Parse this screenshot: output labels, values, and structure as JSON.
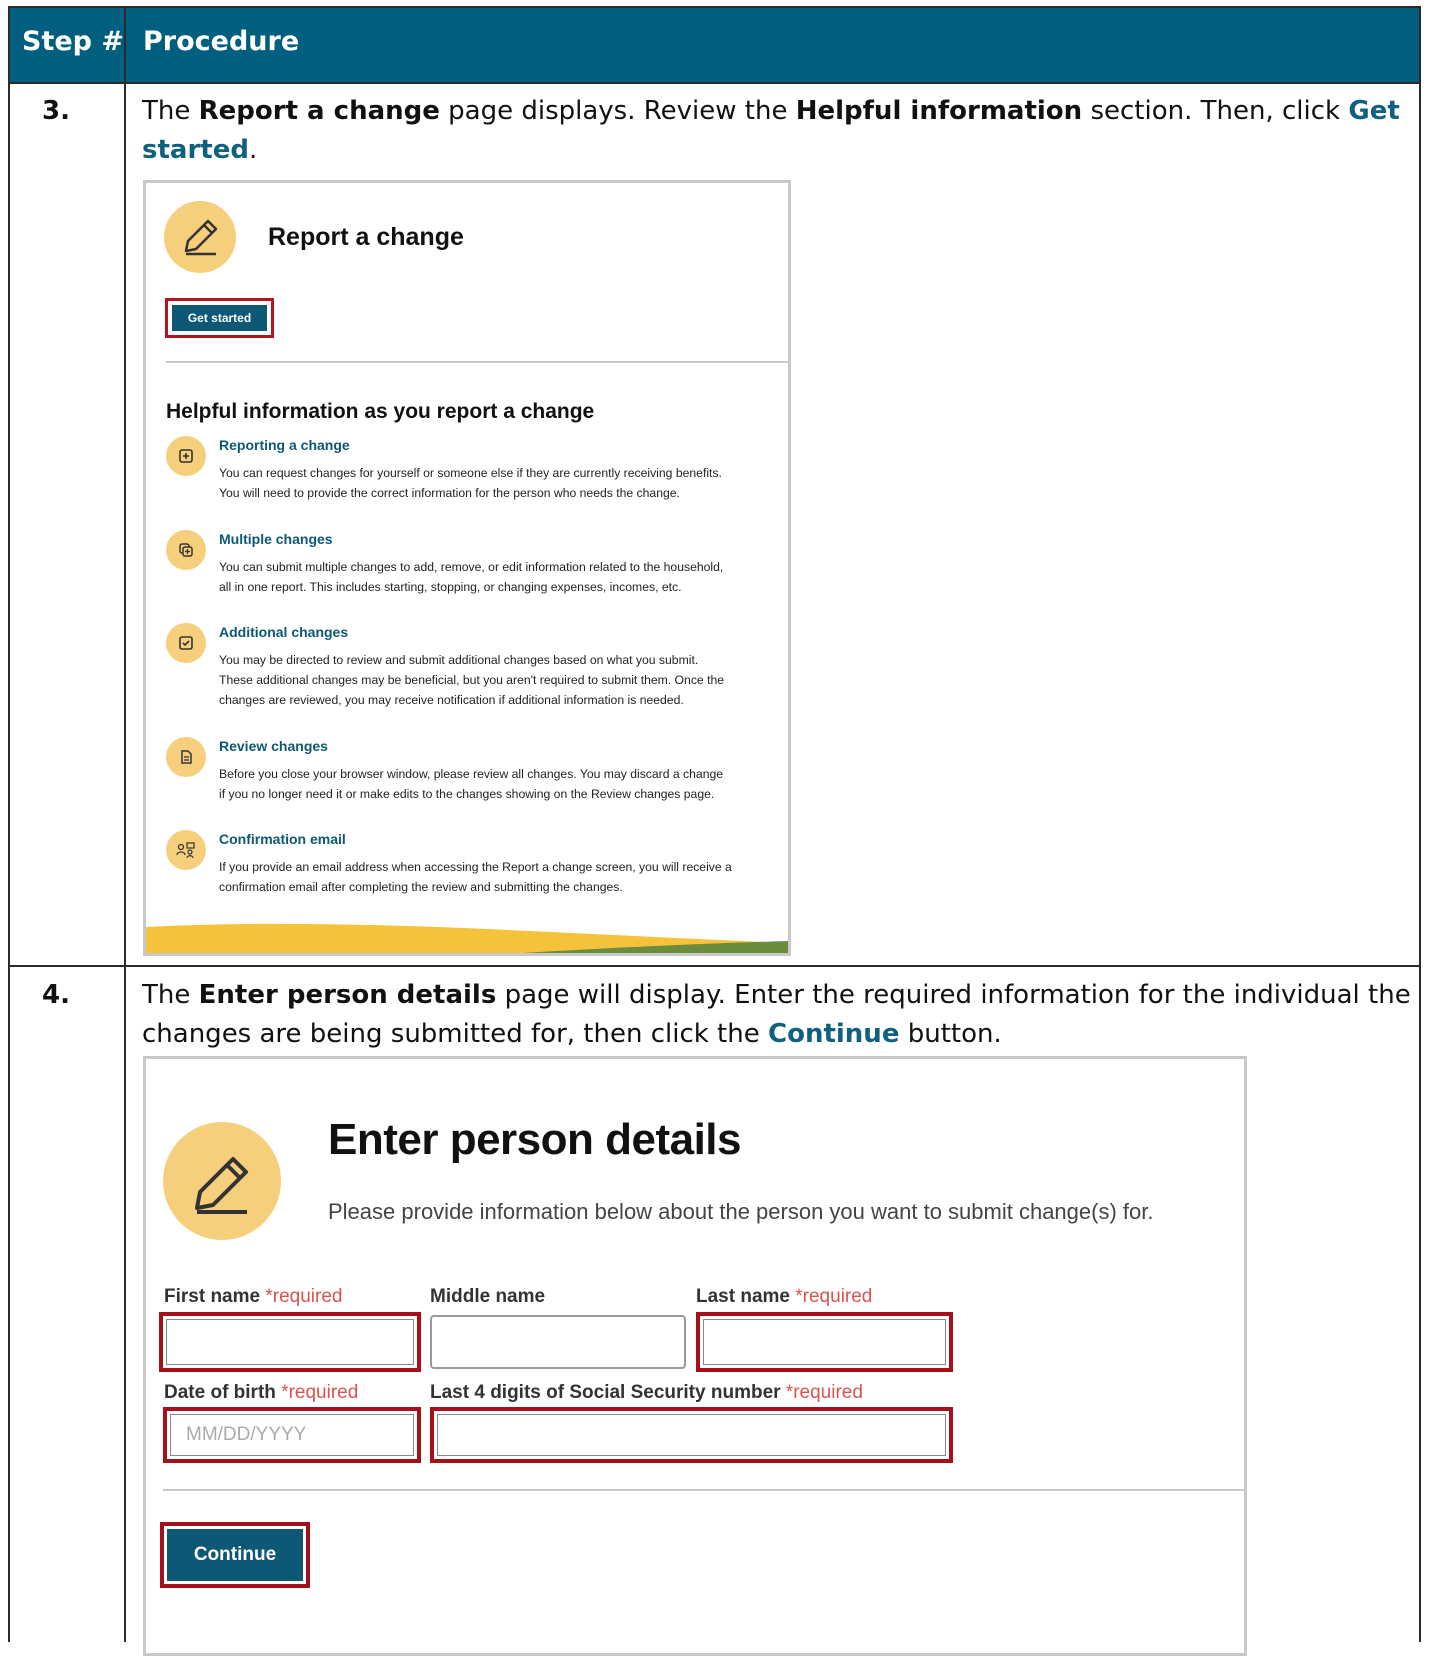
{
  "table": {
    "header": {
      "step": "Step #",
      "procedure": "Procedure"
    }
  },
  "rows": [
    {
      "step": "3.",
      "text_parts": [
        "The ",
        "Report a change",
        " page displays. Review the ",
        "Helpful information",
        " section. Then, click ",
        "Get",
        "started",
        "."
      ],
      "screenshot": {
        "title": "Report a change",
        "button": "Get started",
        "section_heading": "Helpful information as you report a change",
        "items": [
          {
            "icon": "plus-square-icon",
            "title": "Reporting a change",
            "lines": [
              "You can request changes for yourself or someone else if they are currently receiving benefits.",
              "You will need to provide the correct information for the person who needs the change."
            ]
          },
          {
            "icon": "copy-plus-icon",
            "title": "Multiple changes",
            "lines": [
              "You can submit multiple changes to add, remove, or edit information related to the household,",
              "all in one report. This includes starting, stopping, or changing expenses, incomes, etc."
            ]
          },
          {
            "icon": "check-square-icon",
            "title": "Additional changes",
            "lines": [
              "You may be directed to review and submit additional changes based on what you submit.",
              "These additional changes may be beneficial, but you aren't required to submit them. Once the",
              "changes are reviewed, you may receive notification if additional information is needed."
            ]
          },
          {
            "icon": "document-icon",
            "title": "Review changes",
            "lines": [
              "Before you close your browser window, please review all changes. You may discard a change",
              "if you no longer need it or make edits to the changes showing on the Review changes page."
            ]
          },
          {
            "icon": "people-email-icon",
            "title": "Confirmation email",
            "lines": [
              "If you provide an email address when accessing the Report a change screen, you will receive a",
              "confirmation email after completing the review and submitting the changes."
            ]
          }
        ]
      }
    },
    {
      "step": "4.",
      "text_parts": [
        "The ",
        "Enter person details",
        " page will display. Enter the required information for the individual the",
        "changes are being submitted for, then click the ",
        "Continue",
        " button."
      ],
      "screenshot": {
        "title": "Enter person details",
        "subtitle": "Please provide information below about the person you want to submit change(s) for.",
        "required_text": "*required",
        "fields": {
          "first_name": "First name",
          "middle_name": "Middle name",
          "last_name": "Last name",
          "dob": "Date of birth",
          "dob_placeholder": "MM/DD/YYYY",
          "ssn": "Last 4 digits of Social Security number"
        },
        "button": "Continue"
      }
    }
  ],
  "colors": {
    "header_bg": "#005e7e",
    "link": "#10617f",
    "highlight": "#a4111b",
    "icon_bg": "#f6cf7c",
    "button_bg": "#0d5874"
  }
}
